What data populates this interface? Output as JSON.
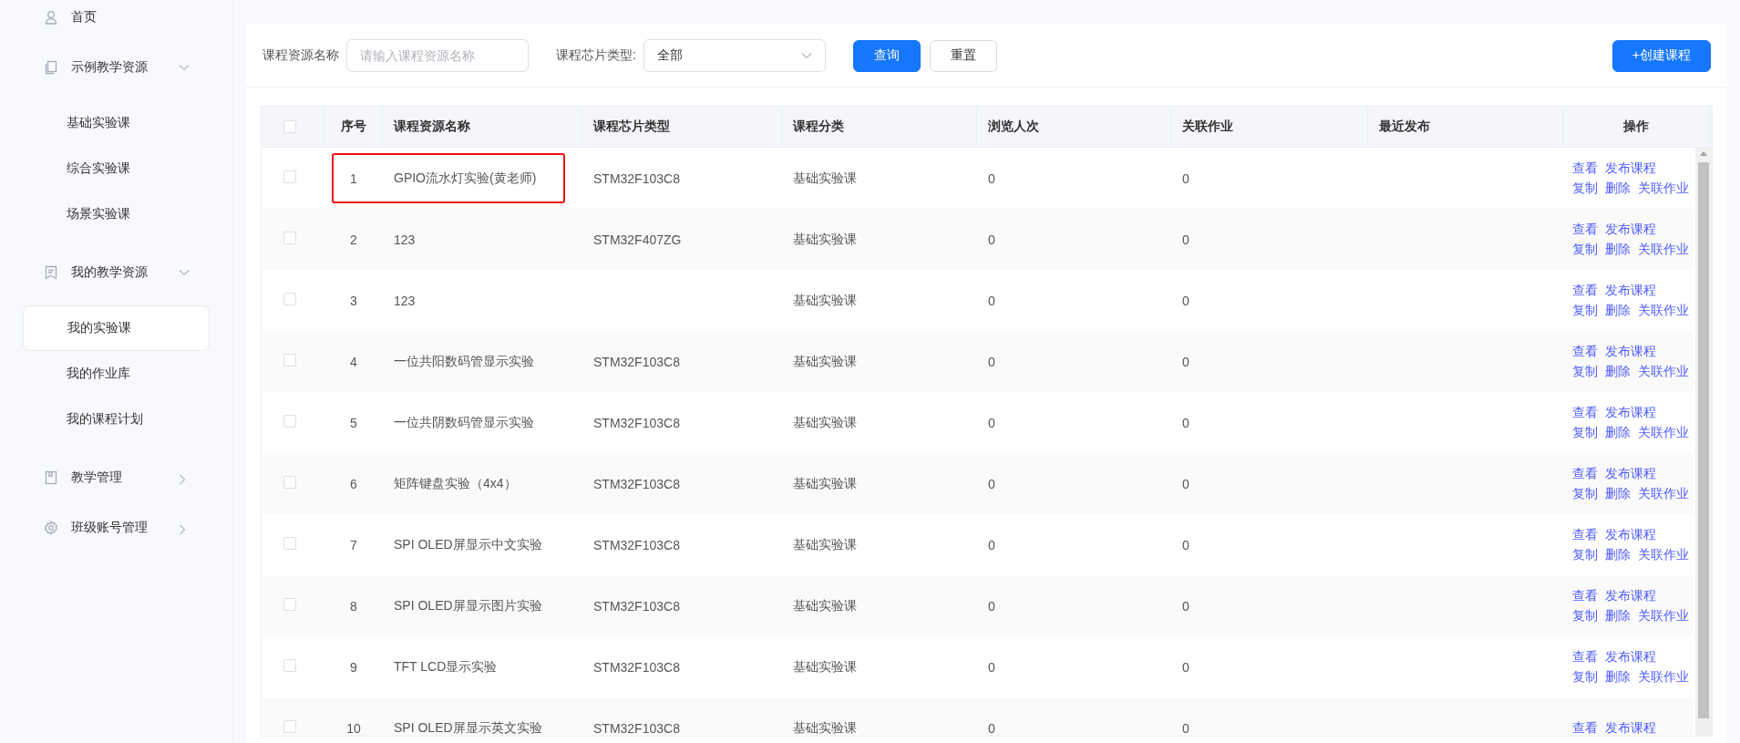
{
  "sidebar": {
    "items": [
      {
        "label": "首页",
        "kind": "link"
      },
      {
        "label": "示例教学资源",
        "kind": "group",
        "expanded": true,
        "children": [
          {
            "label": "基础实验课",
            "selected": false
          },
          {
            "label": "综合实验课",
            "selected": false
          },
          {
            "label": "场景实验课",
            "selected": false
          }
        ]
      },
      {
        "label": "我的教学资源",
        "kind": "group",
        "expanded": true,
        "children": [
          {
            "label": "我的实验课",
            "selected": true
          },
          {
            "label": "我的作业库",
            "selected": false
          },
          {
            "label": "我的课程计划",
            "selected": false
          }
        ]
      },
      {
        "label": "教学管理",
        "kind": "group",
        "expanded": false
      },
      {
        "label": "班级账号管理",
        "kind": "group",
        "expanded": false
      }
    ]
  },
  "filters": {
    "name_label": "课程资源名称",
    "name_placeholder": "请输入课程资源名称",
    "chip_label": "课程芯片类型:",
    "chip_value": "全部",
    "query_button": "查询",
    "reset_button": "重置",
    "create_button": "+创建课程"
  },
  "table": {
    "header_checked": false,
    "columns": [
      "序号",
      "课程资源名称",
      "课程芯片类型",
      "课程分类",
      "浏览人次",
      "关联作业",
      "最近发布",
      "操作"
    ],
    "rows": [
      {
        "checked": false,
        "highlighted": true,
        "cells": [
          "1",
          "GPIO流水灯实验(黄老师)",
          "STM32F103C8",
          "基础实验课",
          "0",
          "0",
          ""
        ],
        "ops": [
          "查看",
          "发布课程",
          "复制",
          "删除",
          "关联作业"
        ]
      },
      {
        "checked": false,
        "highlighted": false,
        "cells": [
          "2",
          "123",
          "STM32F407ZG",
          "基础实验课",
          "0",
          "0",
          ""
        ],
        "ops": [
          "查看",
          "发布课程",
          "复制",
          "删除",
          "关联作业"
        ]
      },
      {
        "checked": false,
        "highlighted": false,
        "cells": [
          "3",
          "123",
          "",
          "基础实验课",
          "0",
          "0",
          ""
        ],
        "ops": [
          "查看",
          "发布课程",
          "复制",
          "删除",
          "关联作业"
        ]
      },
      {
        "checked": false,
        "highlighted": false,
        "cells": [
          "4",
          "一位共阳数码管显示实验",
          "STM32F103C8",
          "基础实验课",
          "0",
          "0",
          ""
        ],
        "ops": [
          "查看",
          "发布课程",
          "复制",
          "删除",
          "关联作业"
        ]
      },
      {
        "checked": false,
        "highlighted": false,
        "cells": [
          "5",
          "一位共阴数码管显示实验",
          "STM32F103C8",
          "基础实验课",
          "0",
          "0",
          ""
        ],
        "ops": [
          "查看",
          "发布课程",
          "复制",
          "删除",
          "关联作业"
        ]
      },
      {
        "checked": false,
        "highlighted": false,
        "cells": [
          "6",
          "矩阵键盘实验（4x4）",
          "STM32F103C8",
          "基础实验课",
          "0",
          "0",
          ""
        ],
        "ops": [
          "查看",
          "发布课程",
          "复制",
          "删除",
          "关联作业"
        ]
      },
      {
        "checked": false,
        "highlighted": false,
        "cells": [
          "7",
          "SPI OLED屏显示中文实验",
          "STM32F103C8",
          "基础实验课",
          "0",
          "0",
          ""
        ],
        "ops": [
          "查看",
          "发布课程",
          "复制",
          "删除",
          "关联作业"
        ]
      },
      {
        "checked": false,
        "highlighted": false,
        "cells": [
          "8",
          "SPI OLED屏显示图片实验",
          "STM32F103C8",
          "基础实验课",
          "0",
          "0",
          ""
        ],
        "ops": [
          "查看",
          "发布课程",
          "复制",
          "删除",
          "关联作业"
        ]
      },
      {
        "checked": false,
        "highlighted": false,
        "cells": [
          "9",
          "TFT LCD显示实验",
          "STM32F103C8",
          "基础实验课",
          "0",
          "0",
          ""
        ],
        "ops": [
          "查看",
          "发布课程",
          "复制",
          "删除",
          "关联作业"
        ]
      },
      {
        "checked": false,
        "highlighted": false,
        "cells": [
          "10",
          "SPI OLED屏显示英文实验",
          "STM32F103C8",
          "基础实验课",
          "0",
          "0",
          ""
        ],
        "ops": [
          "查看",
          "发布课程"
        ]
      }
    ]
  }
}
